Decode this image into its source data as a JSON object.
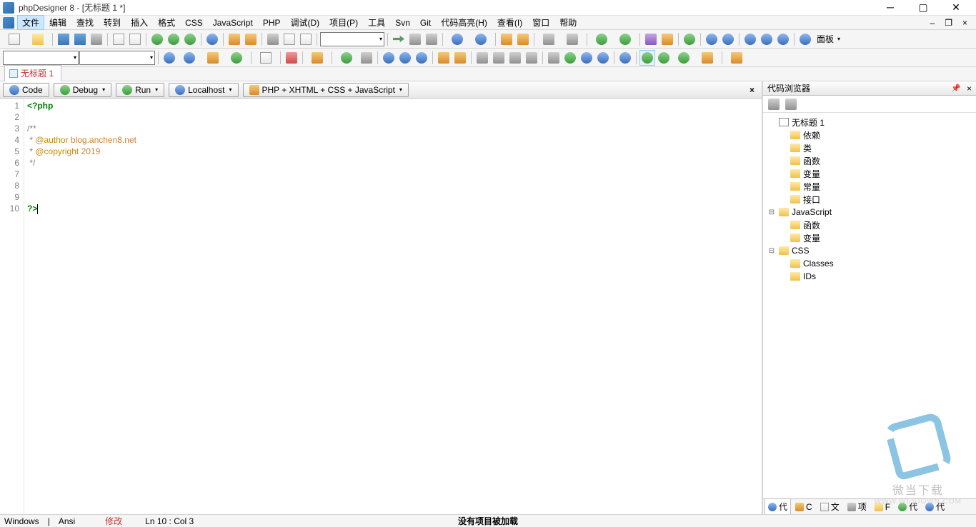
{
  "window": {
    "title": "phpDesigner 8 - [无标题 1 *]"
  },
  "menu": {
    "items": [
      "文件",
      "编辑",
      "查找",
      "转到",
      "插入",
      "格式",
      "CSS",
      "JavaScript",
      "PHP",
      "调试(D)",
      "项目(P)",
      "工具",
      "Svn",
      "Git",
      "代码高亮(H)",
      "查看(I)",
      "窗口",
      "帮助"
    ]
  },
  "toolbar2_panel_label": "面板",
  "file_tab": {
    "label": "无标题 1"
  },
  "editor_tabs": {
    "code": "Code",
    "debug": "Debug",
    "run": "Run",
    "localhost": "Localhost",
    "lang": "PHP + XHTML + CSS + JavaScript"
  },
  "code": {
    "lines": [
      "1",
      "2",
      "3",
      "4",
      "5",
      "6",
      "7",
      "8",
      "9",
      "10"
    ],
    "l1_open": "<?",
    "l1_php": "php",
    "l3": "/**",
    "l4_star": " * ",
    "l4_tag": "@author ",
    "l4_val": "blog.anchen8.net",
    "l5_star": " * ",
    "l5_tag": "@copyright ",
    "l5_val": "2019",
    "l6": " */",
    "l10": "?>"
  },
  "side": {
    "title": "代码浏览器",
    "root": "无标题 1",
    "php_children": [
      "依赖",
      "类",
      "函数",
      "变量",
      "常量",
      "接口"
    ],
    "js_label": "JavaScript",
    "js_children": [
      "函数",
      "变量"
    ],
    "css_label": "CSS",
    "css_children": [
      "Classes",
      "IDs"
    ]
  },
  "side_tabs": [
    "代",
    "C",
    "文",
    "项",
    "F",
    "代",
    "代"
  ],
  "status": {
    "os": "Windows",
    "enc": "Ansi",
    "mod": "修改",
    "pos": "Ln    10 : Col   3",
    "msg": "没有项目被加载"
  },
  "watermark": {
    "text": "微当下载",
    "url": "WWW.WEIDOWN.COM"
  }
}
